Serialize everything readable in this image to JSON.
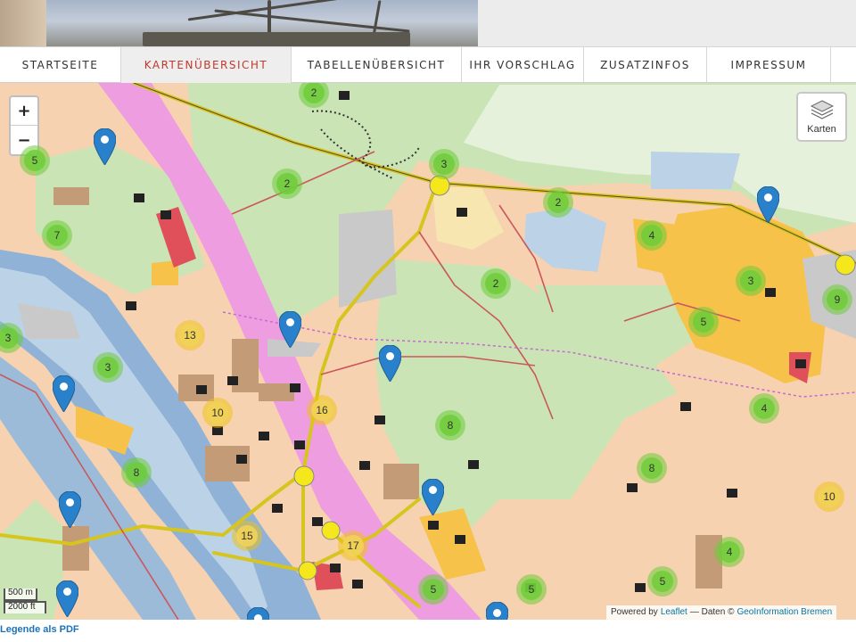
{
  "nav": {
    "items": [
      {
        "label": "STARTSEITE",
        "active": false
      },
      {
        "label": "KARTENÜBERSICHT",
        "active": true
      },
      {
        "label": "TABELLENÜBERSICHT",
        "active": false
      },
      {
        "label": "IHR VORSCHLAG",
        "active": false
      },
      {
        "label": "ZUSATZINFOS",
        "active": false
      },
      {
        "label": "IMPRESSUM",
        "active": false
      }
    ]
  },
  "map": {
    "zoom_in": "+",
    "zoom_out": "−",
    "layers_label": "Karten",
    "scale_metric": "500 m",
    "scale_imperial": "2000 ft",
    "attribution": {
      "powered_by": "Powered by",
      "leaflet": "Leaflet",
      "daten": "— Daten ©",
      "source": "GeoInformation Bremen"
    },
    "clusters": [
      "2",
      "5",
      "2",
      "3",
      "2",
      "7",
      "4",
      "2",
      "3",
      "9",
      "13",
      "5",
      "3",
      "3",
      "4",
      "10",
      "16",
      "8",
      "8",
      "8",
      "10",
      "15",
      "17",
      "4",
      "5",
      "5",
      "5"
    ],
    "marker_count_note": ""
  },
  "footer": {
    "legend_link": "Legende als PDF"
  },
  "colors": {
    "active_nav": "#c0392b",
    "cluster_green": "#6ecc39",
    "cluster_yellow": "#f1d357",
    "marker_blue": "#2a81cb",
    "link_blue": "#1a73b8"
  }
}
